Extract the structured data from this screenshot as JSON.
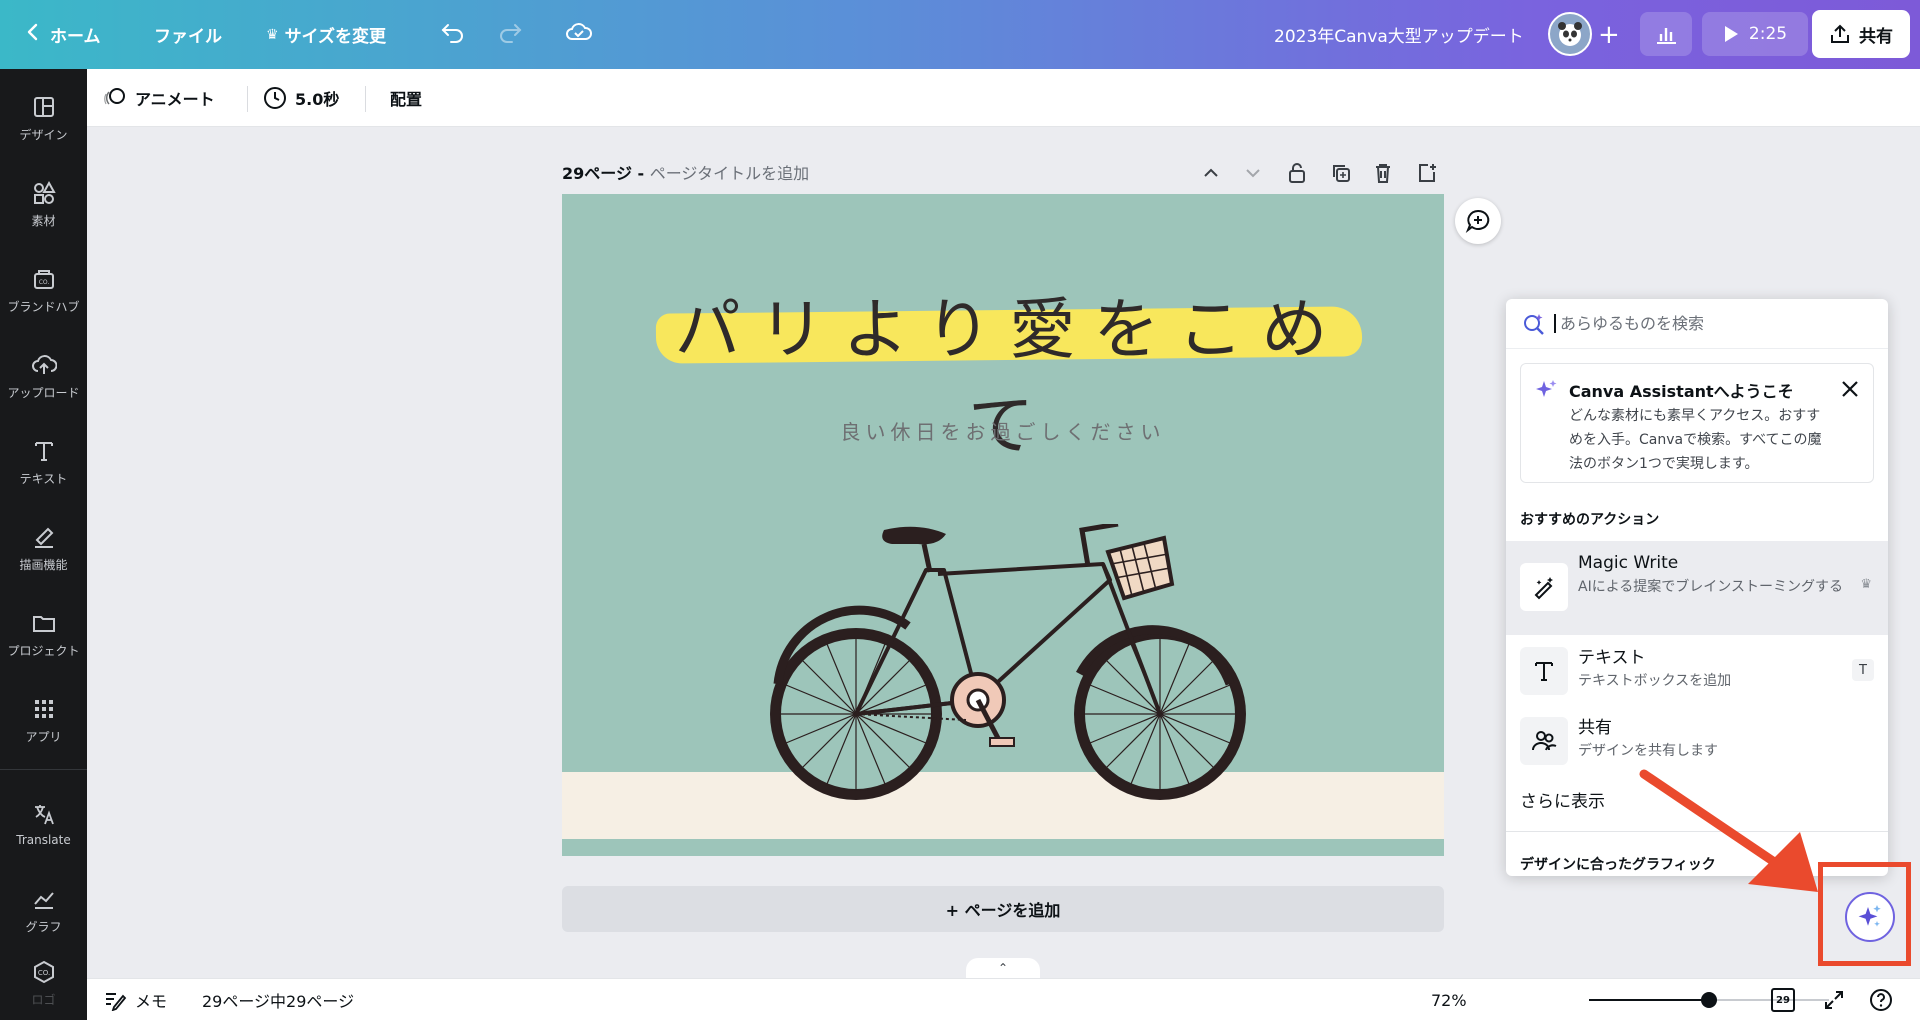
{
  "topbar": {
    "home_label": "ホーム",
    "file_label": "ファイル",
    "resize_label": "サイズを変更",
    "doc_title": "2023年Canva大型アップデート",
    "play_time": "2:25",
    "share_label": "共有"
  },
  "sidebar": {
    "items": [
      {
        "label": "デザイン",
        "icon": "layout-icon"
      },
      {
        "label": "素材",
        "icon": "elements-icon"
      },
      {
        "label": "ブランドハブ",
        "icon": "brand-icon"
      },
      {
        "label": "アップロード",
        "icon": "upload-icon"
      },
      {
        "label": "テキスト",
        "icon": "text-icon"
      },
      {
        "label": "描画機能",
        "icon": "draw-icon"
      },
      {
        "label": "プロジェクト",
        "icon": "folder-icon"
      },
      {
        "label": "アプリ",
        "icon": "apps-icon"
      },
      {
        "label": "Translate",
        "icon": "translate-icon"
      },
      {
        "label": "グラフ",
        "icon": "chart-icon"
      },
      {
        "label": "ロゴ",
        "icon": "logo-icon"
      }
    ]
  },
  "subbar": {
    "animate_label": "アニメート",
    "duration_label": "5.0秒",
    "position_label": "配置"
  },
  "page": {
    "number_label": "29ページ - ",
    "title_placeholder": "ページタイトルを追加",
    "canvas_title": "パリより愛をこめて",
    "canvas_subtitle": "良い休日をお過ごしください",
    "add_page_label": "+ ページを追加"
  },
  "assistant": {
    "search_placeholder": "あらゆるものを検索",
    "welcome_title": "Canva Assistantへようこそ",
    "welcome_desc": "どんな素材にも素早くアクセス。おすすめを入手。Canvaで検索。すべてこの魔法のボタン1つで実現します。",
    "recommended_label": "おすすめのアクション",
    "actions": [
      {
        "title": "Magic Write",
        "desc": "AIによる提案でブレインストーミングする",
        "icon": "magic-write-icon",
        "badge": "crown-icon"
      },
      {
        "title": "テキスト",
        "desc": "テキストボックスを追加",
        "icon": "text-icon",
        "shortcut": "T"
      },
      {
        "title": "共有",
        "desc": "デザインを共有します",
        "icon": "share-people-icon"
      }
    ],
    "more_label": "さらに表示",
    "graphics_label": "デザインに合ったグラフィック"
  },
  "bottombar": {
    "notes_label": "メモ",
    "page_count": "29ページ中29ページ",
    "zoom": "72%",
    "zoom_fraction": 0.5,
    "page_badge": "29"
  },
  "colors": {
    "canvas_bg": "#9dc5ba",
    "highlight": "#f8e75c",
    "annotation_red": "#ea4a2d",
    "accent_purple": "#6f63e0"
  }
}
